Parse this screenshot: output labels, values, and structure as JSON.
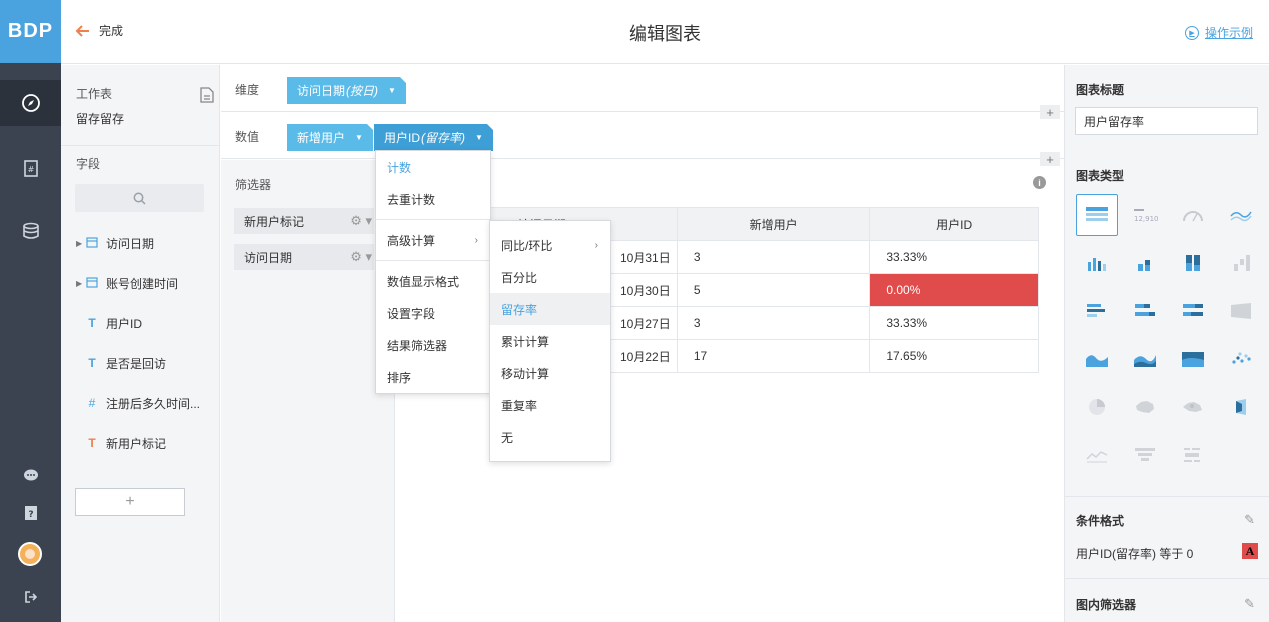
{
  "logo": "BDP",
  "header": {
    "back_label": "完成",
    "title": "编辑图表",
    "example_label": "操作示例"
  },
  "fields_panel": {
    "worksheet_label": "工作表",
    "worksheet_name": "留存留存",
    "fields_label": "字段",
    "items": [
      {
        "label": "访问日期",
        "icon": "calendar-icon",
        "expandable": true
      },
      {
        "label": "账号创建时间",
        "icon": "calendar-icon",
        "expandable": true
      },
      {
        "label": "用户ID",
        "icon": "text-T-icon",
        "expandable": false
      },
      {
        "label": "是否是回访",
        "icon": "text-T-icon",
        "expandable": false
      },
      {
        "label": "注册后多久时间...",
        "icon": "hash-icon",
        "expandable": false
      },
      {
        "label": "新用户标记",
        "icon": "text-T-orange-icon",
        "expandable": false
      }
    ],
    "add_label": "+"
  },
  "shelves": {
    "dimension_label": "维度",
    "dimension_pill": {
      "name": "访问日期",
      "qualifier": "(按日)"
    },
    "value_label": "数值",
    "value_pills": [
      {
        "name": "新增用户",
        "qualifier": ""
      },
      {
        "name": "用户ID",
        "qualifier": "(留存率)"
      }
    ],
    "plus": "+"
  },
  "filters": {
    "title": "筛选器",
    "items": [
      "新用户标记",
      "访问日期"
    ]
  },
  "value_menu": {
    "items": [
      "计数",
      "去重计数",
      "高级计算",
      "数值显示格式",
      "设置字段",
      "结果筛选器",
      "排序"
    ],
    "selected": "计数"
  },
  "advanced_submenu": {
    "items": [
      "同比/环比",
      "百分比",
      "留存率",
      "累计计算",
      "移动计算",
      "重复率",
      "无"
    ],
    "hovered": "留存率"
  },
  "table": {
    "headers": [
      "访问日期",
      "新增用户",
      "用户ID"
    ],
    "rows": [
      [
        "10月31日",
        "3",
        "33.33%"
      ],
      [
        "10月30日",
        "5",
        "0.00%"
      ],
      [
        "10月27日",
        "3",
        "33.33%"
      ],
      [
        "10月22日",
        "17",
        "17.65%"
      ]
    ],
    "highlight_color": "#e04b4b"
  },
  "right_panel": {
    "chart_title_label": "图表标题",
    "chart_title_value": "用户留存率",
    "chart_type_label": "图表类型",
    "conditional_format_label": "条件格式",
    "conditional_rule": "用户ID(留存率) 等于 0",
    "conditional_badge": "A",
    "in_chart_filter_label": "图内筛选器"
  },
  "colors": {
    "accent": "#4aa3df",
    "nav_bg": "#3b4350",
    "pill": "#5bbbe8",
    "highlight": "#e04b4b",
    "back_arrow": "#ef7f4d"
  }
}
